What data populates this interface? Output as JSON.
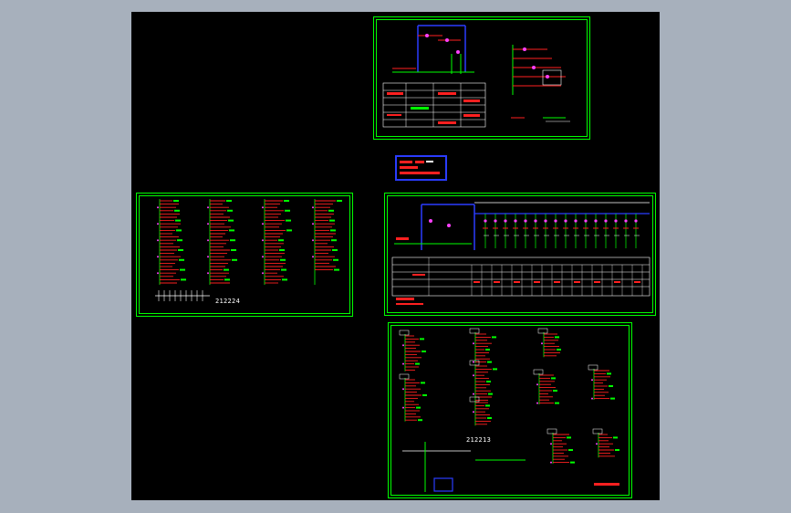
{
  "viewport": {
    "background": "#a7b0bc",
    "canvas_background": "#000000"
  },
  "colors": {
    "border": "#00ff00",
    "wire": "#00ff00",
    "bus": "#2a3cff",
    "breaker": "#ff2020",
    "node": "#ff40ff",
    "text": "#ffffff",
    "accent": "#ffff00",
    "cyan": "#00ffff"
  },
  "sheets": [
    {
      "id": "sheet-top-right",
      "code": ""
    },
    {
      "id": "sheet-left-middle",
      "code": "212224"
    },
    {
      "id": "sheet-right-middle",
      "code": ""
    },
    {
      "id": "sheet-bottom-right",
      "code": "212213"
    }
  ],
  "title_block": {
    "text": ""
  }
}
